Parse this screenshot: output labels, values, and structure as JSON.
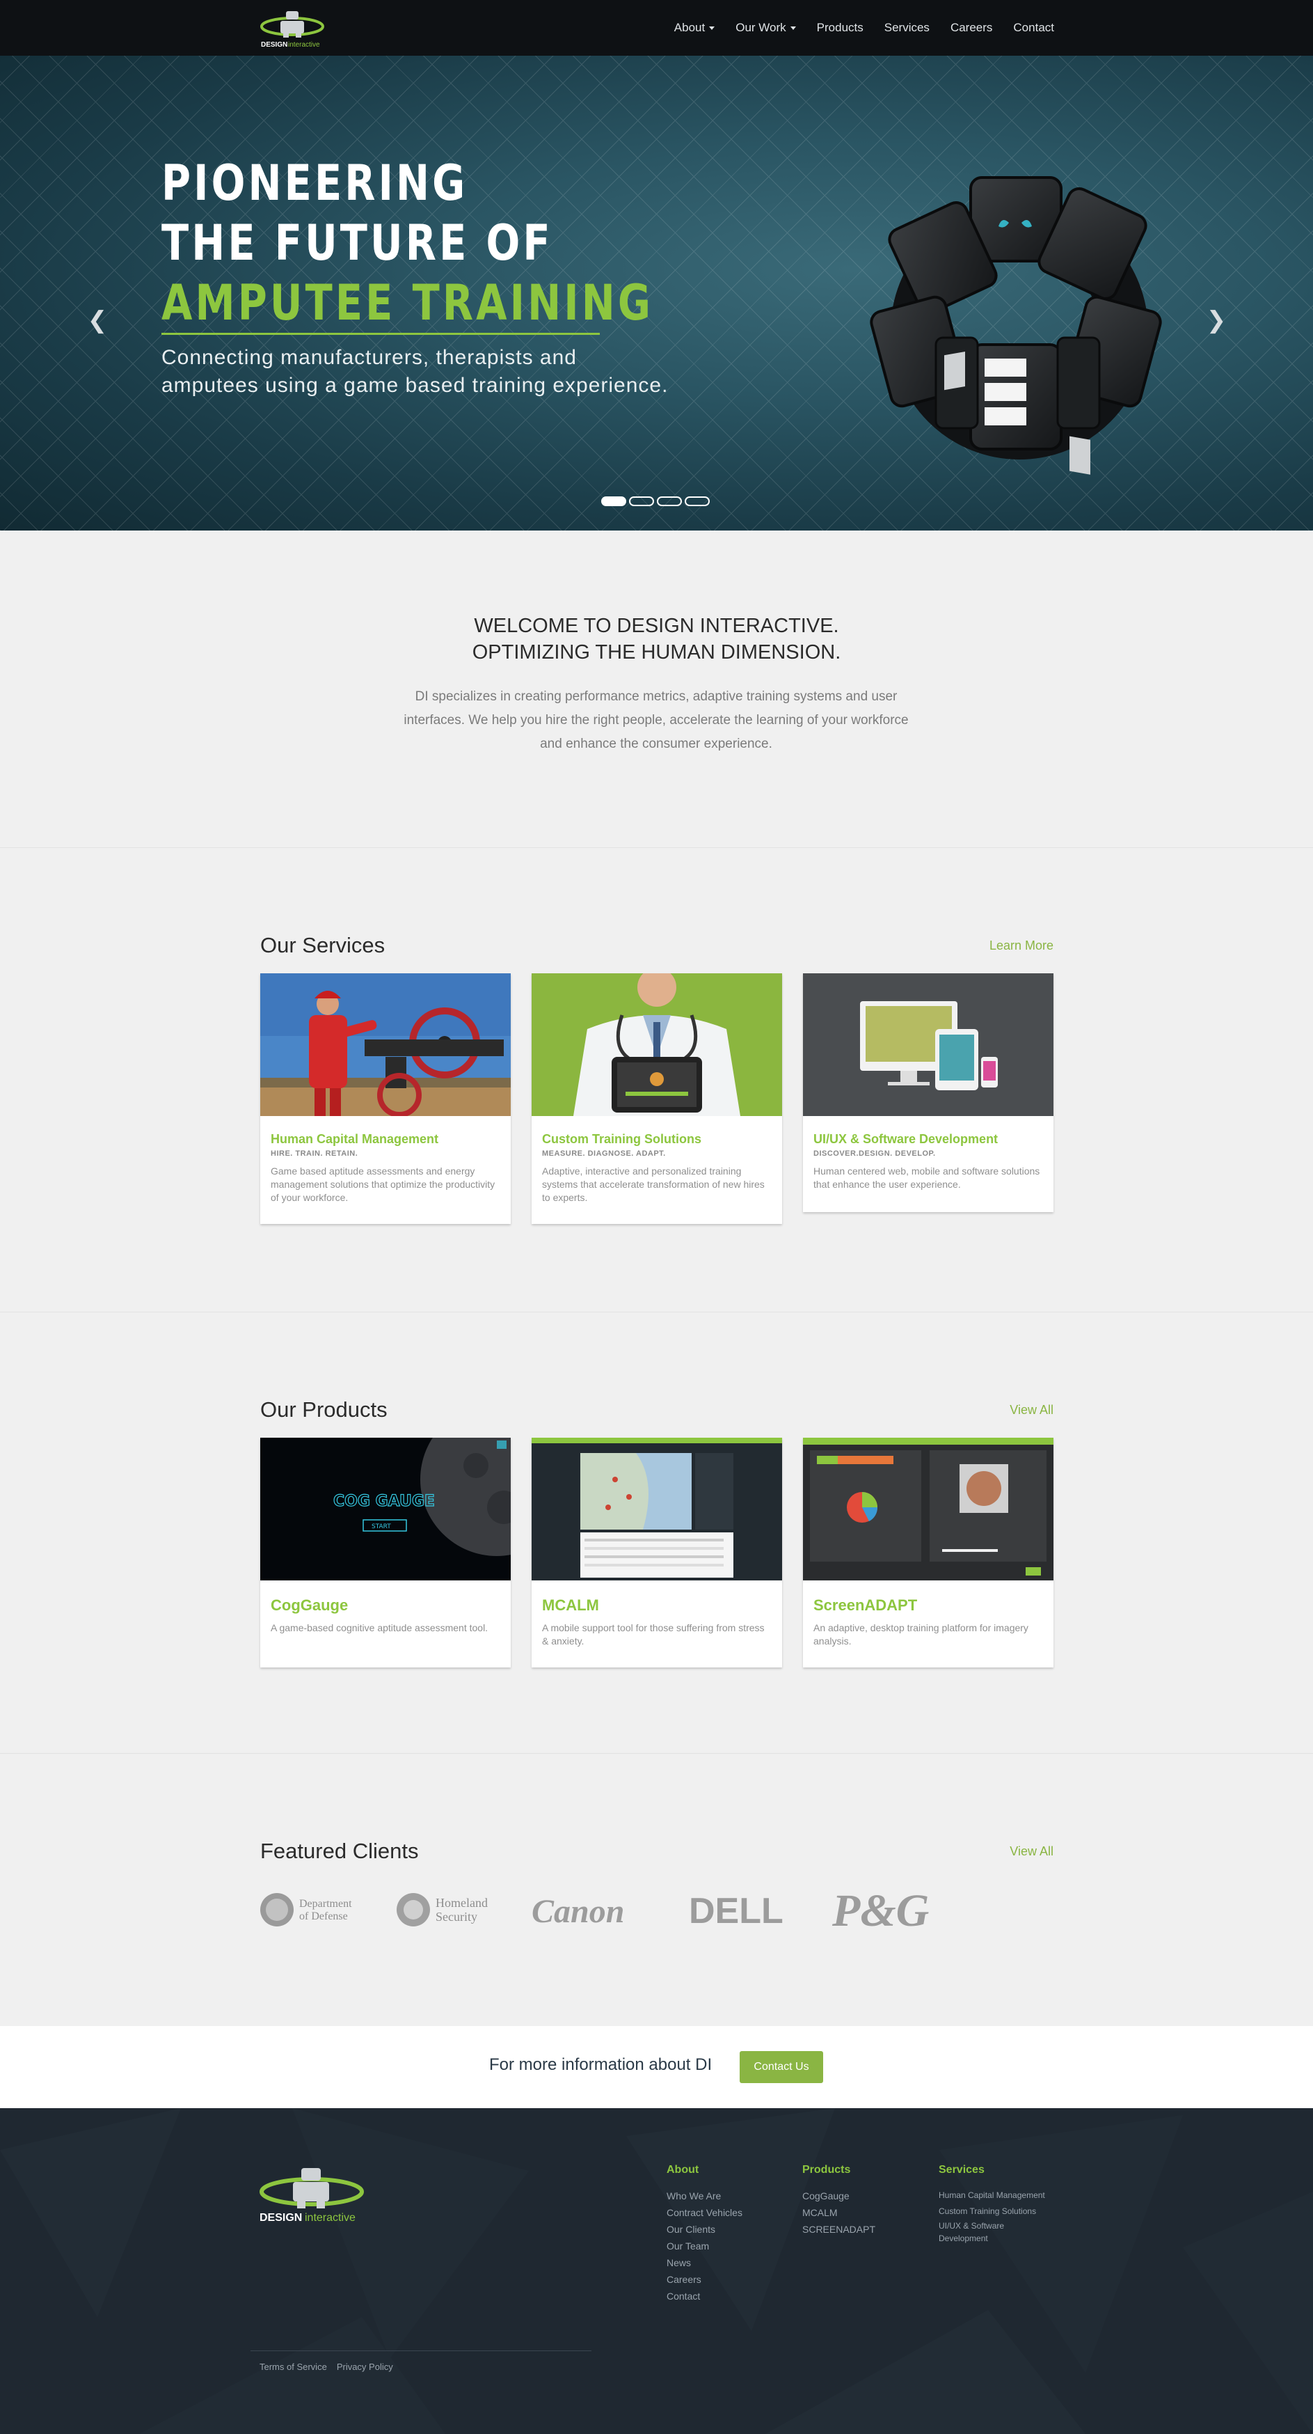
{
  "nav": {
    "logo_text_1": "DESIGN",
    "logo_text_2": "interactive",
    "items": [
      {
        "label": "About",
        "dropdown": true
      },
      {
        "label": "Our Work",
        "dropdown": true
      },
      {
        "label": "Products",
        "dropdown": false
      },
      {
        "label": "Services",
        "dropdown": false
      },
      {
        "label": "Careers",
        "dropdown": false
      },
      {
        "label": "Contact",
        "dropdown": false
      }
    ]
  },
  "hero": {
    "title_line1": "PIONEERING",
    "title_line2": "THE FUTURE OF",
    "title_line3": "AMPUTEE TRAINING",
    "subtitle_line1": "Connecting manufacturers, therapists and",
    "subtitle_line2": "amputees using a game based training experience.",
    "prev_icon": "chevron-left-icon",
    "next_icon": "chevron-right-icon",
    "slide_count": 4,
    "active_slide": 1
  },
  "welcome": {
    "heading_line1": "WELCOME TO DESIGN INTERACTIVE.",
    "heading_line2": "OPTIMIZING THE HUMAN DIMENSION.",
    "body": "DI specializes in creating performance metrics, adaptive training systems and user interfaces. We help you hire the right people, accelerate the learning of your workforce and enhance the consumer experience."
  },
  "services": {
    "title": "Our Services",
    "link": "Learn More",
    "cards": [
      {
        "title": "Human Capital Management",
        "tag": "HIRE. TRAIN. RETAIN.",
        "desc": "Game based aptitude assessments and energy management solutions that optimize the productivity of your workforce."
      },
      {
        "title": "Custom Training Solutions",
        "tag": "MEASURE. DIAGNOSE. ADAPT.",
        "desc": "Adaptive, interactive and personalized training systems that accelerate transformation of new hires to experts."
      },
      {
        "title": "UI/UX & Software Development",
        "tag": "DISCOVER.DESIGN. DEVELOP.",
        "desc": "Human centered web, mobile and software solutions that enhance the user experience."
      }
    ]
  },
  "products": {
    "title": "Our Products",
    "link": "View All",
    "cards": [
      {
        "title": "CogGauge",
        "desc": "A game-based cognitive aptitude assessment tool.",
        "screen_title": "COG GAUGE",
        "screen_button": "START"
      },
      {
        "title": "MCALM",
        "desc": "A mobile support tool for those suffering from stress & anxiety."
      },
      {
        "title": "ScreenADAPT",
        "desc": "An adaptive, desktop training platform for imagery analysis."
      }
    ]
  },
  "clients": {
    "title": "Featured Clients",
    "link": "View All",
    "logos": [
      {
        "line1": "Department",
        "line2": "of Defense"
      },
      {
        "line1": "Homeland",
        "line2": "Security"
      },
      {
        "name": "Canon"
      },
      {
        "name": "DELL"
      },
      {
        "name": "P&G"
      }
    ]
  },
  "cta": {
    "text": "For more information about DI",
    "button": "Contact Us"
  },
  "footer": {
    "logo_text_1": "DESIGN",
    "logo_text_2": "interactive",
    "columns": [
      {
        "heading": "About",
        "links": [
          "Who We Are",
          "Contract Vehicles",
          "Our Clients",
          "Our Team",
          "News",
          "Careers",
          "Contact"
        ]
      },
      {
        "heading": "Products",
        "links": [
          "CogGauge",
          "MCALM",
          "SCREENADAPT"
        ]
      },
      {
        "heading": "Services",
        "links": [
          "Human Capital Management",
          "Custom Training Solutions",
          "UI/UX & Software",
          "Development"
        ]
      }
    ],
    "legal": [
      "Terms of Service",
      "Privacy Policy"
    ]
  },
  "colors": {
    "accent": "#8dc63f",
    "button": "#8ab543",
    "nav_bg": "#0e1114",
    "footer_bg": "#1f2831",
    "page_bg": "#f0f0f0"
  }
}
